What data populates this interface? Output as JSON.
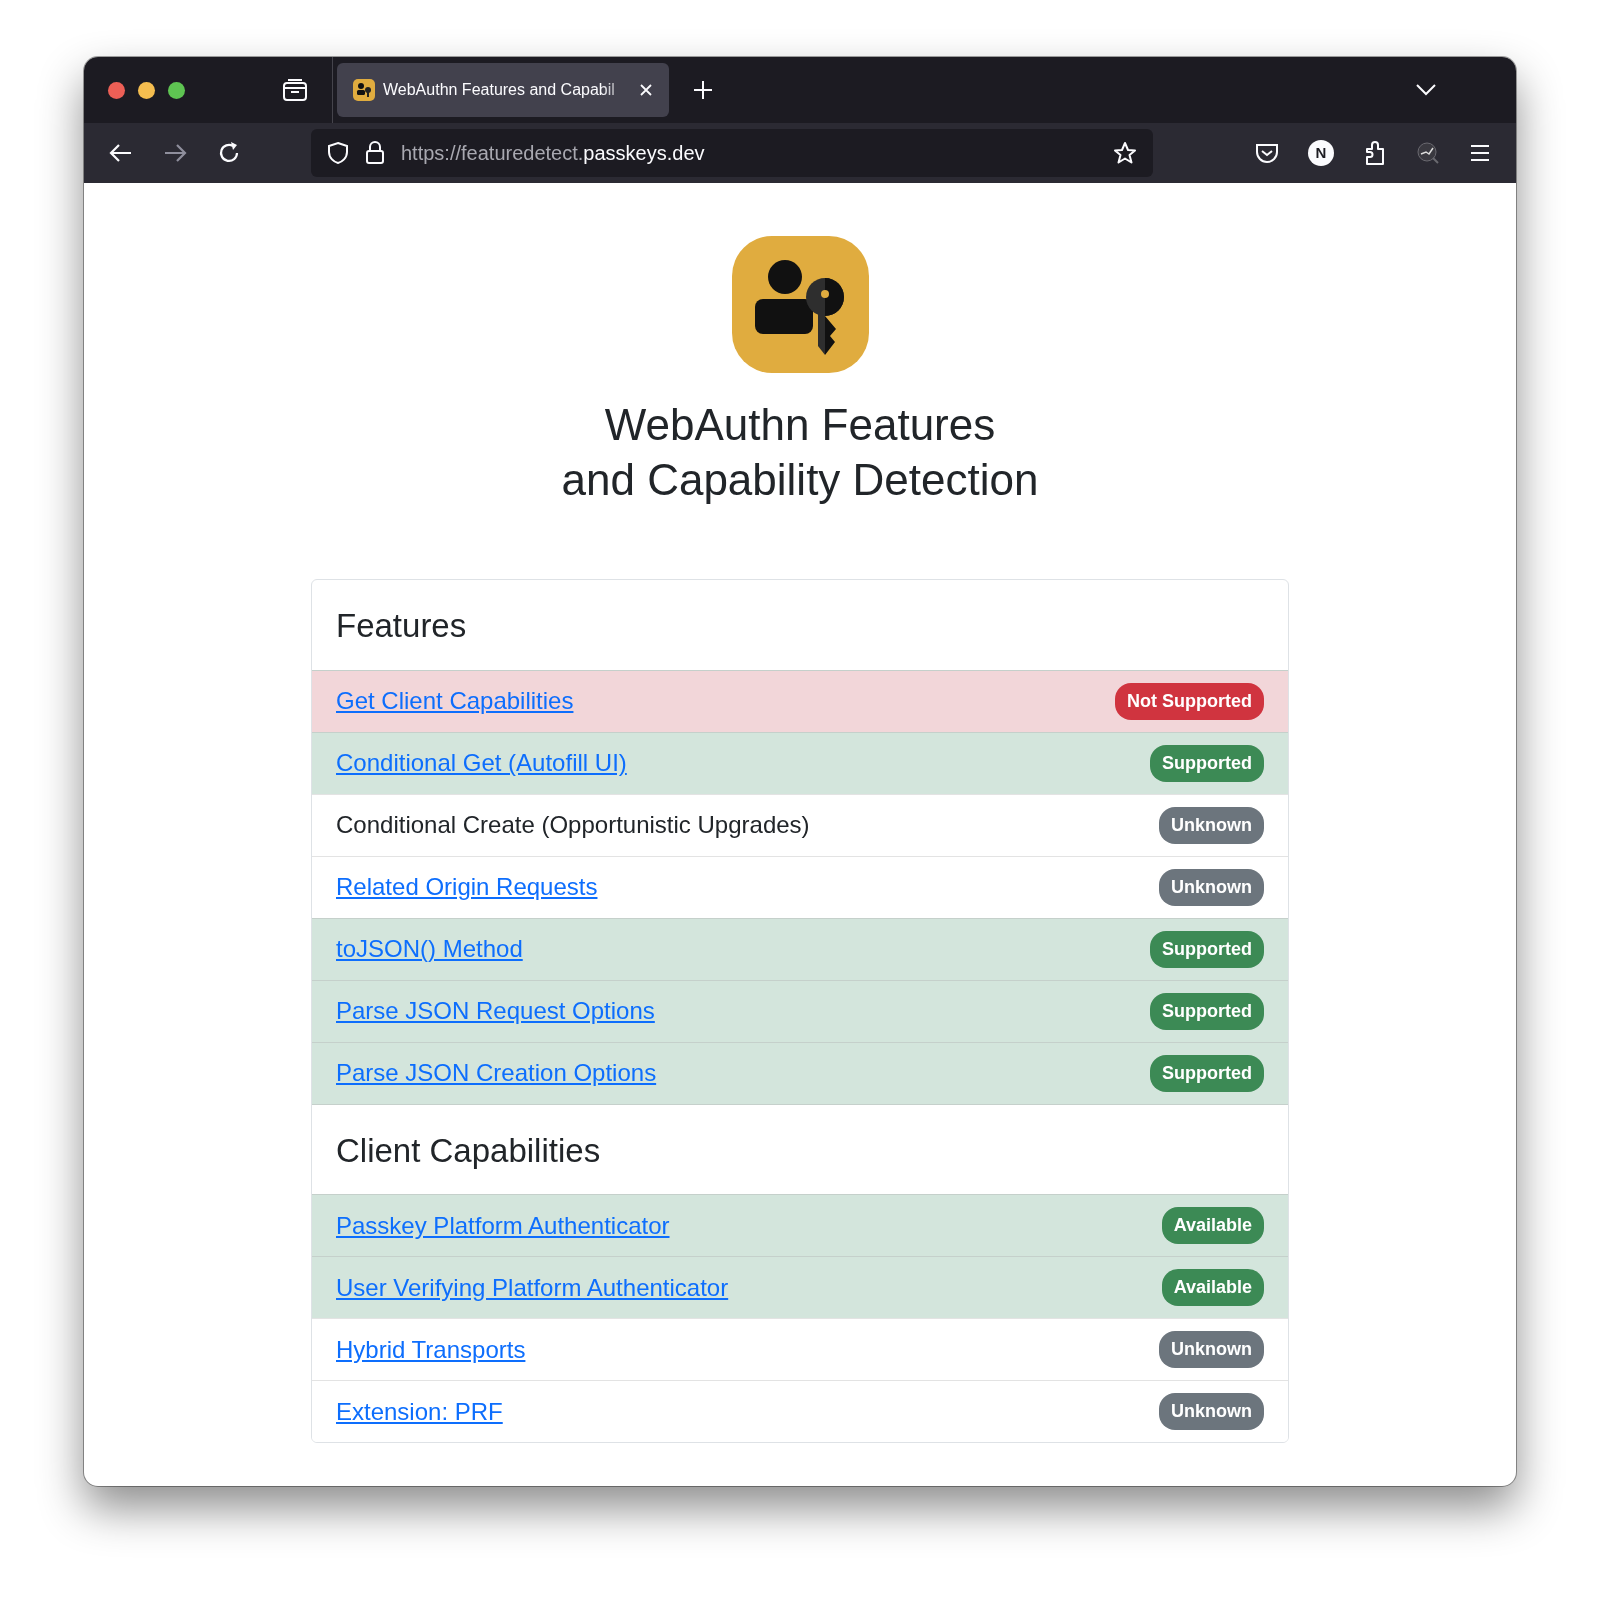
{
  "browser": {
    "tab_title": "WebAuthn Features and Capabil",
    "url_prefix": "https://featuredetect.",
    "url_domain": "passkeys.dev",
    "profile_initial": "N"
  },
  "page": {
    "title_lines": [
      "WebAuthn Features",
      "and Capability Detection"
    ]
  },
  "sections": [
    {
      "heading": "Features",
      "rows": [
        {
          "label": "Get Client Capabilities",
          "link": true,
          "status": "Not Supported",
          "kind": "danger"
        },
        {
          "label": "Conditional Get (Autofill UI)",
          "link": true,
          "status": "Supported",
          "kind": "success"
        },
        {
          "label": "Conditional Create (Opportunistic Upgrades)",
          "link": false,
          "status": "Unknown",
          "kind": "unknown"
        },
        {
          "label": "Related Origin Requests",
          "link": true,
          "status": "Unknown",
          "kind": "unknown"
        },
        {
          "label": "toJSON() Method",
          "link": true,
          "status": "Supported",
          "kind": "success"
        },
        {
          "label": "Parse JSON Request Options",
          "link": true,
          "status": "Supported",
          "kind": "success"
        },
        {
          "label": "Parse JSON Creation Options",
          "link": true,
          "status": "Supported",
          "kind": "success"
        }
      ]
    },
    {
      "heading": "Client Capabilities",
      "rows": [
        {
          "label": "Passkey Platform Authenticator",
          "link": true,
          "status": "Available",
          "kind": "success"
        },
        {
          "label": "User Verifying Platform Authenticator",
          "link": true,
          "status": "Available",
          "kind": "success"
        },
        {
          "label": "Hybrid Transports",
          "link": true,
          "status": "Unknown",
          "kind": "unknown"
        },
        {
          "label": "Extension: PRF",
          "link": true,
          "status": "Unknown",
          "kind": "unknown"
        }
      ]
    }
  ]
}
